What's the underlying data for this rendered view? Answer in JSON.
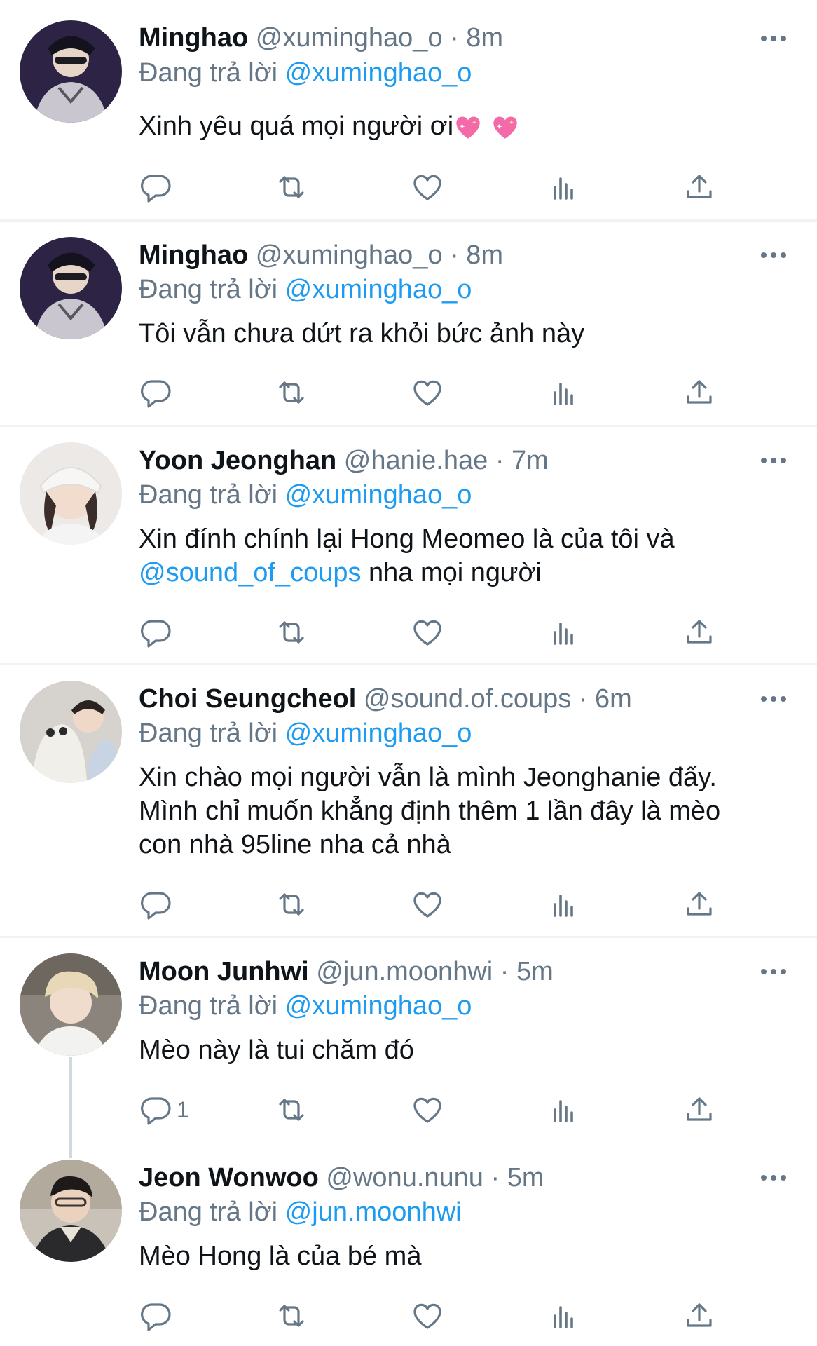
{
  "tweets": [
    {
      "name": "Minghao",
      "handle": "@xuminghao_o",
      "time": "8m",
      "reply_prefix": "Đang trả lời",
      "reply_to": "@xuminghao_o",
      "text": "Xinh yêu quá mọi người ơi",
      "emoji": [
        "sparkling-heart",
        "sparkling-heart"
      ]
    },
    {
      "name": "Minghao",
      "handle": "@xuminghao_o",
      "time": "8m",
      "reply_prefix": "Đang trả lời",
      "reply_to": "@xuminghao_o",
      "text": "Tôi vẫn chưa dứt ra khỏi bức ảnh này"
    },
    {
      "name": "Yoon Jeonghan",
      "handle": "@hanie.hae",
      "time": "7m",
      "reply_prefix": "Đang trả lời",
      "reply_to": "@xuminghao_o",
      "text_line1": "Xin đính chính lại Hong Meomeo là của tôi và",
      "mention": "@sound_of_coups",
      "text_line2_rest": " nha mọi người"
    },
    {
      "name": "Choi Seungcheol",
      "handle": "@sound.of.coups",
      "time": "6m",
      "reply_prefix": "Đang trả lời",
      "reply_to": "@xuminghao_o",
      "text_line1": "Xin chào mọi người vẫn là mình Jeonghanie đấy.",
      "text_line2": "Mình chỉ muốn khẳng định thêm 1 lần đây là mèo",
      "text_line3": "con nhà 95line nha cả nhà"
    },
    {
      "name": "Moon Junhwi",
      "handle": "@jun.moonhwi",
      "time": "5m",
      "reply_prefix": "Đang trả lời",
      "reply_to": "@xuminghao_o",
      "text": "Mèo này là tui chăm đó",
      "reply_count": "1"
    },
    {
      "name": "Jeon Wonwoo",
      "handle": "@wonu.nunu",
      "time": "5m",
      "reply_prefix": "Đang trả lời",
      "reply_to": "@jun.moonhwi",
      "text": "Mèo Hong là của bé mà"
    }
  ],
  "separator": "·",
  "icons": [
    "reply-icon",
    "retweet-icon",
    "like-icon",
    "analytics-icon",
    "share-icon",
    "more-icon"
  ],
  "colors": {
    "link": "#1d9bf0",
    "muted": "#657786",
    "text": "#0f1419",
    "divider": "#eff3f4"
  }
}
